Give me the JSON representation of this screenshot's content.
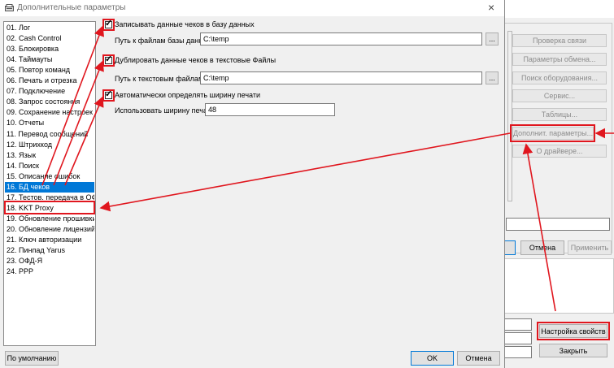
{
  "dialog": {
    "title": "Дополнительные параметры",
    "close_glyph": "×",
    "list": [
      "01. Лог",
      "02. Cash Control",
      "03. Блокировка",
      "04. Таймауты",
      "05. Повтор команд",
      "06. Печать и отрезка",
      "07. Подключение",
      "08. Запрос состояния",
      "09. Сохранение настроек",
      "10. Отчеты",
      "11. Перевод сообщений",
      "12. Штрихкод",
      "13. Язык",
      "14. Поиск",
      "15. Описание ошибок",
      "16. БД чеков",
      "17. Тестов. передача в ОФД",
      "18. KKT Proxy",
      "19. Обновление прошивки",
      "20. Обновление лицензий",
      "21. Ключ авторизации",
      "22. Пинпад Yarus",
      "23. ОФД-Я",
      "24. PPP"
    ],
    "selected_index": 15,
    "options": {
      "write_db_label": "Записывать данные чеков в базу данных",
      "db_path_label": "Путь к файлам базы данных:",
      "db_path_value": "C:\\temp",
      "dup_text_label": "Дублировать данные чеков в текстовые Файлы",
      "text_path_label": "Путь к текстовым файлам:",
      "text_path_value": "C:\\temp",
      "auto_width_label": "Автоматически определять ширину печати",
      "width_label": "Использовать ширину печати:",
      "width_value": "48",
      "browse": "..."
    },
    "footer": {
      "default_btn": "По умолчанию",
      "ok_btn": "OK",
      "cancel_btn": "Отмена"
    }
  },
  "back_window": {
    "buttons": [
      "Проверка связи",
      "Параметры обмена...",
      "Поиск оборудования...",
      "Сервис...",
      "Таблицы...",
      "Дополнит. параметры...",
      "О драйвере..."
    ],
    "bottom": {
      "cancel": "Отмена",
      "apply": "Применить"
    },
    "props_btn": "Настройка свойств",
    "close_btn": "Закрыть"
  },
  "colors": {
    "highlight": "#e0161e",
    "selection": "#0078d7"
  }
}
